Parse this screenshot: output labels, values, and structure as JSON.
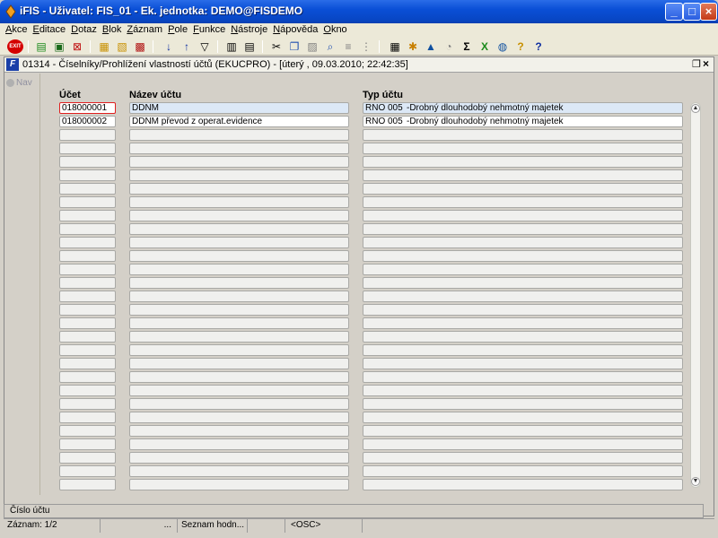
{
  "window": {
    "title": "iFIS - Uživatel: FIS_01 - Ek. jednotka: DEMO@FISDEMO"
  },
  "menu": [
    "Akce",
    "Editace",
    "Dotaz",
    "Blok",
    "Záznam",
    "Pole",
    "Funkce",
    "Nástroje",
    "Nápověda",
    "Okno"
  ],
  "toolbar": {
    "exit_label": "EXIT"
  },
  "form": {
    "title": "01314 - Číselníky/Prohlížení vlastností účtů (EKUCPRO) - [úterý , 09.03.2010; 22:42:35]",
    "nav_label": "Nav",
    "headers": {
      "ucet": "Účet",
      "nazev": "Název účtu",
      "typ": "Typ účtu"
    },
    "rows": [
      {
        "ucet": "018000001",
        "nazev": "DDNM",
        "typ_kod": "RNO 005",
        "typ_popis": "-Drobný dlouhodobý nehmotný majetek"
      },
      {
        "ucet": "018000002",
        "nazev": "DDNM převod z operat.evidence",
        "typ_kod": "RNO 005",
        "typ_popis": "-Drobný dlouhodobý nehmotný majetek"
      }
    ]
  },
  "status": {
    "field_hint": "Číslo účtu",
    "record": "Záznam: 1/2",
    "seg3": "...",
    "list": "Seznam hodn...",
    "osc": "<OSC>"
  }
}
